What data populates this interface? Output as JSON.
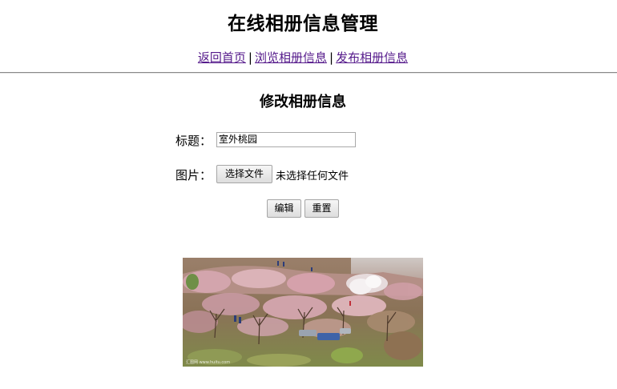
{
  "page": {
    "title": "在线相册信息管理"
  },
  "nav": {
    "home": "返回首页",
    "browse": "浏览相册信息",
    "publish": "发布相册信息",
    "separator": "|"
  },
  "form": {
    "heading": "修改相册信息",
    "title_label": "标题：",
    "title_value": "室外桃园",
    "image_label": "图片：",
    "file_button": "选择文件",
    "file_status": "未选择任何文件",
    "edit_button": "编辑",
    "reset_button": "重置"
  },
  "photo": {
    "watermark": "汇图网 www.huitu.com"
  }
}
